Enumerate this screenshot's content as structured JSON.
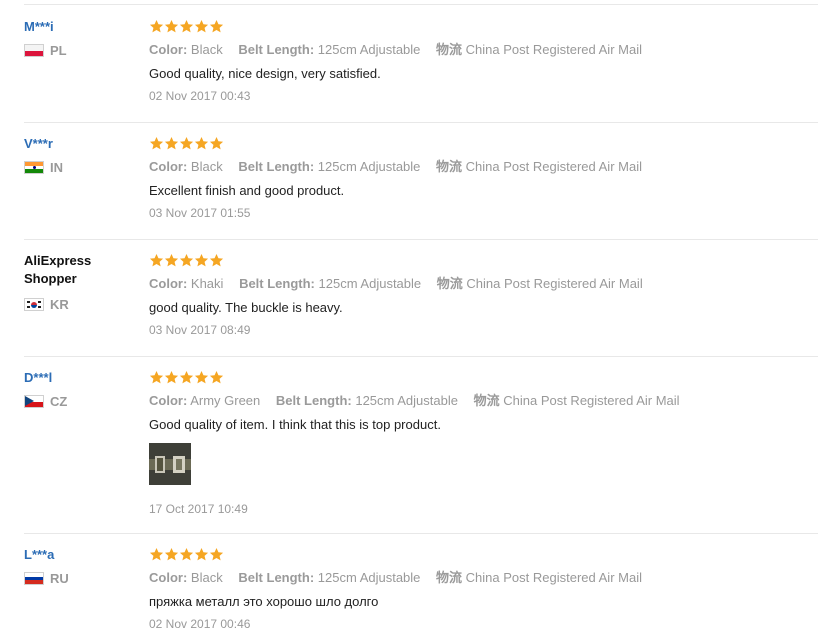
{
  "colors": {
    "stars": "#f5a623",
    "username": "#2b6cb5",
    "meta": "#999999"
  },
  "labels": {
    "color": "Color:",
    "belt": "Belt Length:",
    "shipping": "物流"
  },
  "reviews": [
    {
      "name": "M***i",
      "country": "PL",
      "rating": 5,
      "color": "Black",
      "belt": "125cm Adjustable",
      "shipping": "China Post Registered Air Mail",
      "text": "Good quality, nice design, very satisfied.",
      "date": "02 Nov 2017 00:43"
    },
    {
      "name": "V***r",
      "country": "IN",
      "rating": 5,
      "color": "Black",
      "belt": "125cm Adjustable",
      "shipping": "China Post Registered Air Mail",
      "text": "Excellent finish and good product.",
      "date": "03 Nov 2017 01:55"
    },
    {
      "name_line1": "AliExpress",
      "name_line2": "Shopper",
      "country": "KR",
      "rating": 5,
      "color": "Khaki",
      "belt": "125cm Adjustable",
      "shipping": "China Post Registered Air Mail",
      "text": "good quality. The buckle is heavy.",
      "date": "03 Nov 2017 08:49"
    },
    {
      "name": "D***l",
      "country": "CZ",
      "rating": 5,
      "color": "Army Green",
      "belt": "125cm Adjustable",
      "shipping": "China Post Registered Air Mail",
      "text": "Good quality of item. I think that this is top product.",
      "date": "17 Oct 2017 10:49"
    },
    {
      "name": "L***a",
      "country": "RU",
      "rating": 5,
      "color": "Black",
      "belt": "125cm Adjustable",
      "shipping": "China Post Registered Air Mail",
      "text": "пряжка металл это хорошо шло долго",
      "date": "02 Nov 2017 00:46"
    }
  ]
}
